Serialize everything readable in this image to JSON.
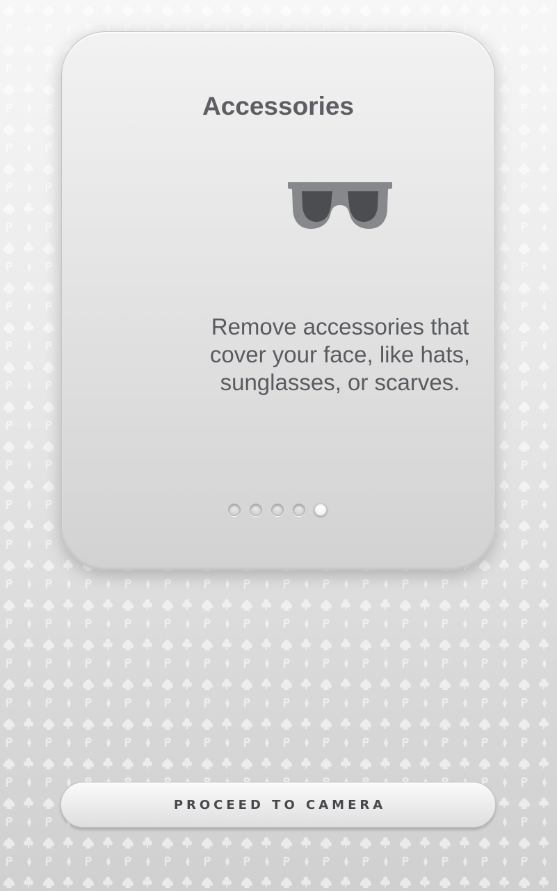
{
  "card": {
    "title": "Accessories",
    "icon": "sunglasses-icon",
    "description": "Remove accessories that cover your face, like hats, sunglasses, or scarves."
  },
  "pagination": {
    "total": 5,
    "current": 5
  },
  "actions": {
    "proceed_label": "PROCEED TO CAMERA"
  },
  "colors": {
    "title": "#5c5e63",
    "text": "#595b60",
    "icon_frame": "#86888b",
    "icon_lens": "#4c4d50"
  }
}
